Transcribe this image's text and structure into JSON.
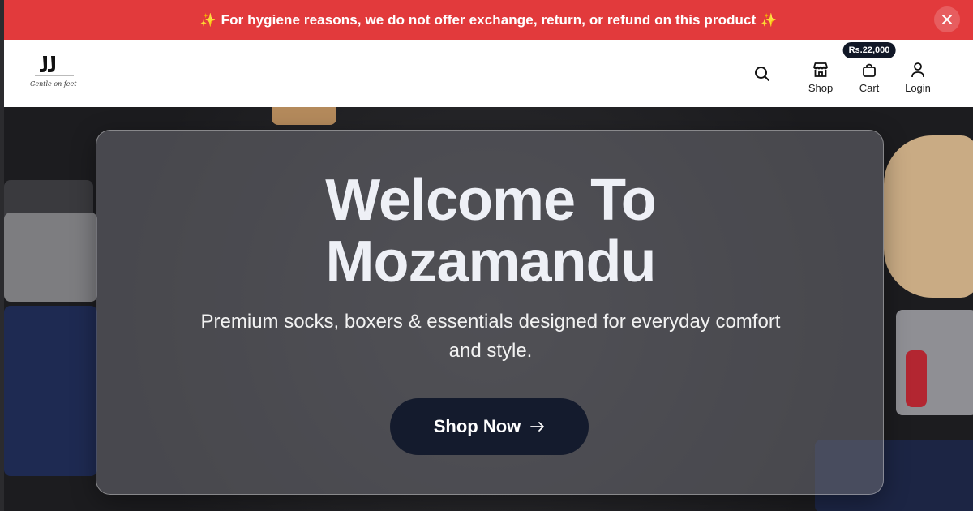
{
  "announcement": {
    "text": "For hygiene reasons, we do not offer exchange, return, or refund on this product",
    "sparkle_icon": "✨"
  },
  "header": {
    "logo_tagline": "Gentle on feet",
    "nav": {
      "shop_label": "Shop",
      "cart_label": "Cart",
      "cart_badge": "Rs.22,000",
      "login_label": "Login"
    }
  },
  "hero": {
    "title_line1": "Welcome To",
    "title_line2": "Mozamandu",
    "subtitle": "Premium socks, boxers & essentials designed for everyday comfort and style.",
    "cta_label": "Shop Now"
  },
  "colors": {
    "announcement_bg": "#e23a3c",
    "cta_bg": "#141b2d",
    "badge_bg": "#111827"
  }
}
